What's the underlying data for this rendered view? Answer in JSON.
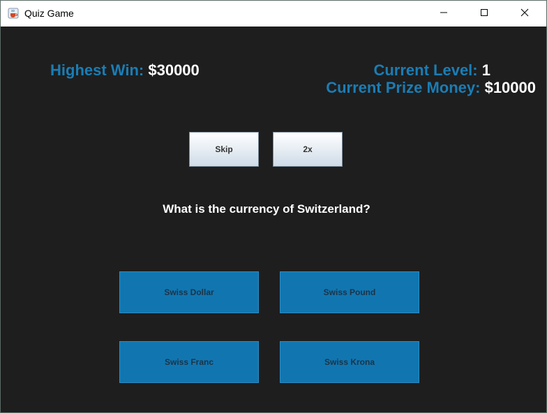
{
  "window": {
    "title": "Quiz Game",
    "icon": "java-cup-icon",
    "controls": [
      "minimize-icon",
      "maximize-icon",
      "close-icon"
    ]
  },
  "stats": {
    "highest_win_label": "Highest Win:",
    "highest_win_value": "$30000",
    "current_level_label": "Current Level:",
    "current_level_value": "1",
    "current_prize_label": "Current Prize Money:",
    "current_prize_value": "$10000"
  },
  "lifelines": {
    "skip_label": "Skip",
    "double_label": "2x"
  },
  "question": {
    "text": "What is the currency of Switzerland?"
  },
  "answers": [
    {
      "label": "Swiss Dollar"
    },
    {
      "label": "Swiss Pound"
    },
    {
      "label": "Swiss Franc"
    },
    {
      "label": "Swiss Krona"
    }
  ],
  "colors": {
    "background": "#1e1e1e",
    "label_blue": "#1a7db5",
    "answer_button": "#1176b0",
    "value_text": "#ffffff"
  }
}
